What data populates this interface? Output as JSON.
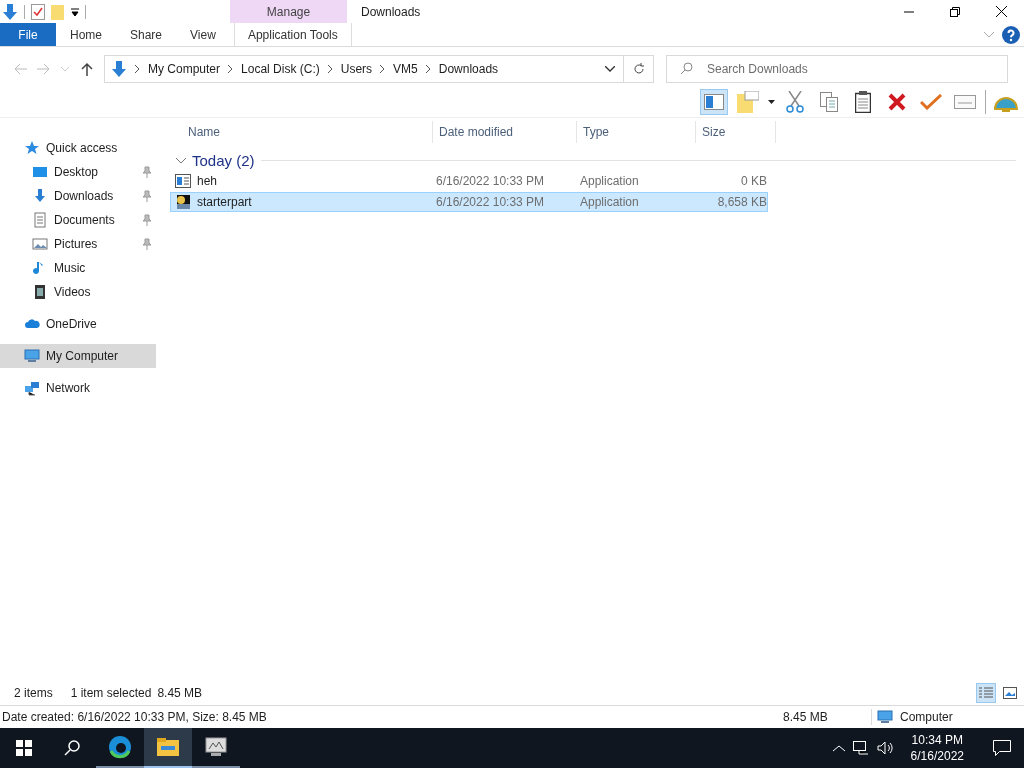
{
  "title_bar": {
    "context_group": "Manage",
    "title": "Downloads"
  },
  "ribbon_tabs": [
    {
      "label": "File",
      "kind": "file"
    },
    {
      "label": "Home",
      "kind": "plain"
    },
    {
      "label": "Share",
      "kind": "plain"
    },
    {
      "label": "View",
      "kind": "plain"
    },
    {
      "label": "Application Tools",
      "kind": "context"
    }
  ],
  "address_bar": {
    "segments": [
      "My Computer",
      "Local Disk (C:)",
      "Users",
      "VM5",
      "Downloads"
    ]
  },
  "search": {
    "placeholder": "Search Downloads"
  },
  "toolbar": {
    "preview_pane_on": true
  },
  "nav_pane": [
    {
      "label": "Quick access",
      "kind": "star",
      "selected": false,
      "children": [
        {
          "label": "Desktop",
          "kind": "desktop",
          "pinned": true,
          "selected": false
        },
        {
          "label": "Downloads",
          "kind": "download",
          "pinned": true,
          "selected": false
        },
        {
          "label": "Documents",
          "kind": "document",
          "pinned": true,
          "selected": false
        },
        {
          "label": "Pictures",
          "kind": "picture",
          "pinned": true,
          "selected": false
        },
        {
          "label": "Music",
          "kind": "music",
          "pinned": false,
          "selected": false
        },
        {
          "label": "Videos",
          "kind": "video",
          "pinned": false,
          "selected": false
        }
      ]
    },
    {
      "label": "OneDrive",
      "kind": "cloud",
      "selected": false
    },
    {
      "label": "My Computer",
      "kind": "computer",
      "selected": true
    },
    {
      "label": "Network",
      "kind": "network",
      "selected": false
    }
  ],
  "columns": [
    "Name",
    "Date modified",
    "Type",
    "Size"
  ],
  "groups": [
    {
      "title": "Today (2)",
      "expanded": true,
      "rows": [
        {
          "name": "heh",
          "date": "6/16/2022 10:33 PM",
          "type": "Application",
          "size": "0 KB",
          "kind": "window",
          "selected": false
        },
        {
          "name": "starterpart",
          "date": "6/16/2022 10:33 PM",
          "type": "Application",
          "size": "8,658 KB",
          "kind": "app",
          "selected": true
        }
      ]
    }
  ],
  "status_bar": {
    "item_count": "2 items",
    "selection": "1 item selected",
    "selection_size": "8.45 MB",
    "views": [
      {
        "kind": "details",
        "selected": true
      },
      {
        "kind": "large",
        "selected": false
      }
    ]
  },
  "details_bar": {
    "text": "Date created: 6/16/2022 10:33 PM, Size: 8.45 MB",
    "size": "8.45 MB",
    "location": "Computer"
  },
  "taskbar": {
    "apps": [
      {
        "kind": "edge",
        "selected": false
      },
      {
        "kind": "explorer",
        "selected": true
      },
      {
        "kind": "tool",
        "selected": false
      }
    ],
    "time": "10:34 PM",
    "date": "6/16/2022"
  }
}
